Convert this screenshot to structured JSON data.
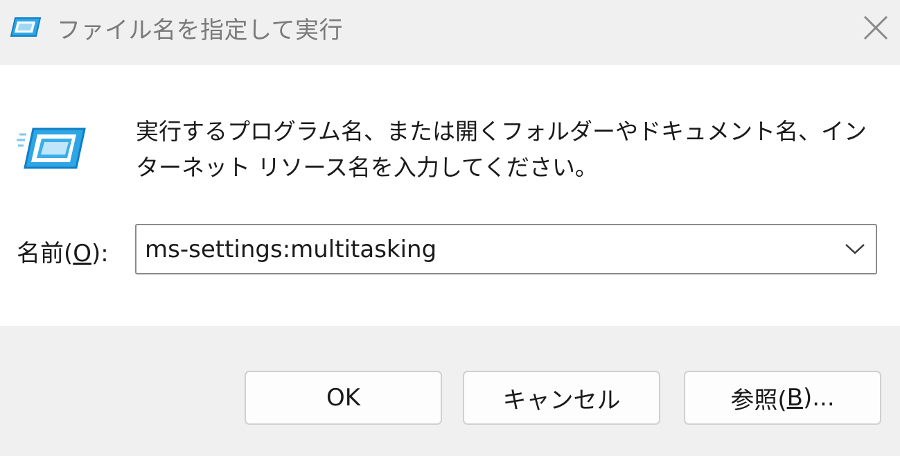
{
  "window": {
    "title": "ファイル名を指定して実行",
    "title_icon": "run-dialog-icon",
    "close_icon": "close-icon"
  },
  "dialog": {
    "description": "実行するプログラム名、または開くフォルダーやドキュメント名、インターネット リソース名を入力してください。",
    "name_label_prefix": "名前(",
    "name_label_accel": "O",
    "name_label_suffix": "):",
    "input_value": "ms-settings:multitasking"
  },
  "buttons": {
    "ok": "OK",
    "cancel": "キャンセル",
    "browse_prefix": "参照(",
    "browse_accel": "B",
    "browse_suffix": ")..."
  },
  "colors": {
    "accent": "#1ba1e2",
    "title_text": "#7a7a7a"
  }
}
